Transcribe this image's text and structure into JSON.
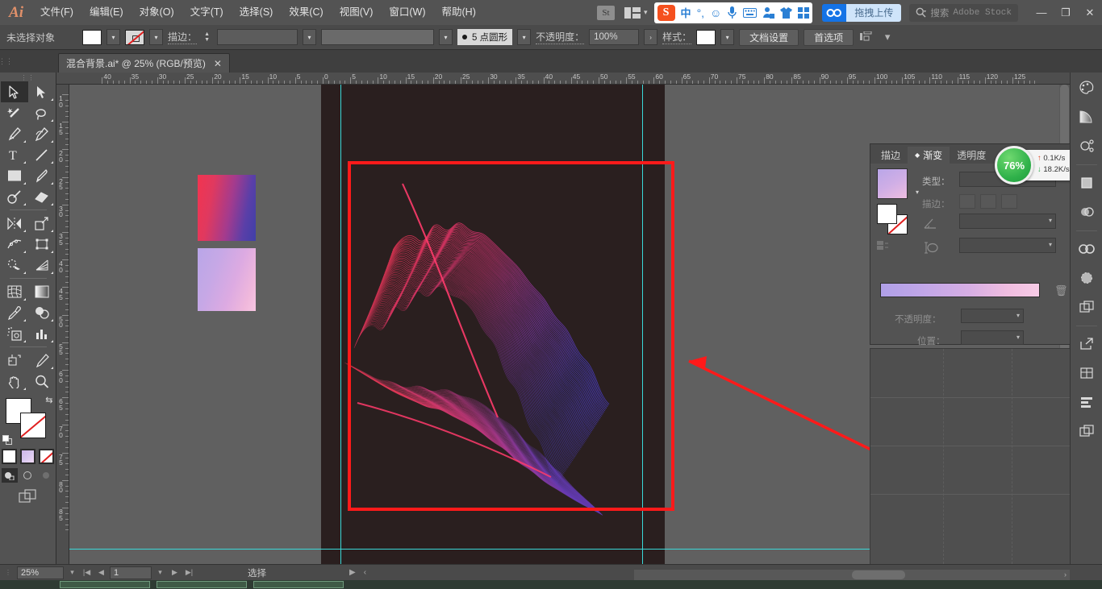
{
  "app": {
    "name": "Adobe Illustrator",
    "logo": "Ai"
  },
  "menubar": {
    "items": [
      {
        "label": "文件(F)"
      },
      {
        "label": "编辑(E)"
      },
      {
        "label": "对象(O)"
      },
      {
        "label": "文字(T)"
      },
      {
        "label": "选择(S)"
      },
      {
        "label": "效果(C)"
      },
      {
        "label": "视图(V)"
      },
      {
        "label": "窗口(W)"
      },
      {
        "label": "帮助(H)"
      }
    ],
    "stock_badge": "St",
    "cc_button": "拖拽上传",
    "search_label": "搜索",
    "search_placeholder": "Adobe Stock",
    "minimize": "—",
    "maximize": "❐",
    "close": "✕"
  },
  "ime": {
    "logo": "S",
    "mode": "中",
    "punct": "°,",
    "emoji": "☺",
    "mic": "🎤",
    "keyboard": "⌨",
    "user": "👤",
    "skin": "👕",
    "apps": "▦"
  },
  "controlbar": {
    "selection_status": "未选择对象",
    "stroke_label": "描边：",
    "stroke_weight": "",
    "brush_label": "5 点圆形",
    "opacity_label": "不透明度：",
    "opacity_value": "100%",
    "style_label": "样式：",
    "doc_setup": "文档设置",
    "preferences": "首选项"
  },
  "tabbar": {
    "doc_tab": "混合背景.ai* @ 25% (RGB/预览)",
    "close": "✕"
  },
  "toolbox": {
    "tools": [
      "selection-tool",
      "direct-selection-tool",
      "magic-wand-tool",
      "lasso-tool",
      "pen-tool",
      "curvature-tool",
      "type-tool",
      "line-segment-tool",
      "rectangle-tool",
      "paintbrush-tool",
      "shaper-tool",
      "eraser-tool",
      "reflect-tool",
      "scale-tool",
      "width-tool",
      "free-transform-tool",
      "shape-builder-tool",
      "perspective-grid-tool",
      "mesh-tool",
      "gradient-tool",
      "eyedropper-tool",
      "blend-tool",
      "symbol-sprayer-tool",
      "column-graph-tool",
      "artboard-tool",
      "slice-tool",
      "hand-tool",
      "zoom-tool"
    ],
    "fill_color": "#ffffff",
    "stroke_color": "none",
    "color_modes": [
      "white-swatch",
      "gradient-swatch",
      "none-swatch"
    ],
    "screen_modes": [
      "normal-screen",
      "full-screen-menubar",
      "full-screen"
    ]
  },
  "rulers": {
    "unit": "mm",
    "horizontal": [
      "40",
      "35",
      "30",
      "25",
      "20",
      "15",
      "10",
      "5",
      "0",
      "5",
      "10",
      "15",
      "20",
      "25",
      "30",
      "35",
      "40",
      "45",
      "50",
      "55",
      "60",
      "65",
      "70",
      "75",
      "80",
      "85",
      "90",
      "95",
      "100",
      "105",
      "110",
      "115",
      "120",
      "125"
    ],
    "vertical": [
      "10",
      "15",
      "20",
      "25",
      "30",
      "35",
      "40",
      "45",
      "50",
      "55",
      "60",
      "65",
      "70",
      "75",
      "80",
      "85"
    ]
  },
  "canvas": {
    "artboard_background": "#2a1f1f",
    "guide_color": "#3ad9d9",
    "annotation_color": "#ff1a1a",
    "gradient_swatch_1": "红色到蓝紫渐变",
    "gradient_swatch_2": "淡紫到粉色渐变",
    "artwork_name": "混合背景线稿"
  },
  "gradient_panel": {
    "tabs": [
      {
        "label": "描边",
        "active": false
      },
      {
        "label": "渐变",
        "active": true
      },
      {
        "label": "透明度",
        "active": false
      }
    ],
    "type_label": "类型：",
    "stroke_label": "描边：",
    "angle_label": "",
    "opacity_label": "不透明度：",
    "location_label": "位置：",
    "gradient_preview": "线性渐变 紫到粉"
  },
  "speed_widget": {
    "percent": "76%",
    "upload": "0.1K/s",
    "download": "18.2K/s",
    "upload_arrow": "↑",
    "download_arrow": "↓",
    "plus": "+"
  },
  "rail": {
    "icons": [
      "color-palette-icon",
      "gradient-panel-icon",
      "symbols-icon",
      "swatches-icon",
      "transparency-icon",
      "creative-cloud-icon",
      "brushes-icon",
      "layers-icon",
      "export-icon",
      "libraries-icon",
      "align-icon",
      "artboards-icon"
    ]
  },
  "statusbar": {
    "zoom": "25%",
    "page": "1",
    "status": "选择",
    "first": "|◀",
    "prev": "◀",
    "next": "▶",
    "last": "▶|"
  }
}
